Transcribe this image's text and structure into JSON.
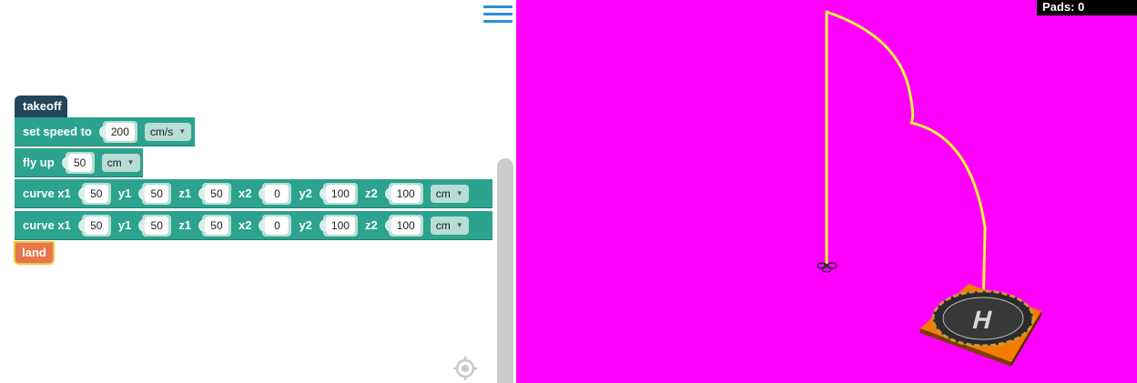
{
  "menu": {
    "icon": "hamburger-menu-icon"
  },
  "blocks": {
    "takeoff": {
      "label": "takeoff",
      "color": "#24465c"
    },
    "set_speed": {
      "label": "set speed to",
      "value": "200",
      "unit": "cm/s"
    },
    "fly_up": {
      "label": "fly up",
      "value": "50",
      "unit": "cm"
    },
    "curves": [
      {
        "label": "curve x1",
        "x1": "50",
        "y1_label": "y1",
        "y1": "50",
        "z1_label": "z1",
        "z1": "50",
        "x2_label": "x2",
        "x2": "0",
        "y2_label": "y2",
        "y2": "100",
        "z2_label": "z2",
        "z2": "100",
        "unit": "cm"
      },
      {
        "label": "curve x1",
        "x1": "50",
        "y1_label": "y1",
        "y1": "50",
        "z1_label": "z1",
        "z1": "50",
        "x2_label": "x2",
        "x2": "0",
        "y2_label": "y2",
        "y2": "100",
        "z2_label": "z2",
        "z2": "100",
        "unit": "cm"
      }
    ],
    "land": {
      "label": "land",
      "color": "#e6764a"
    }
  },
  "controls": {
    "recenter_icon": "target-recenter-icon"
  },
  "simulator": {
    "background": "#ff00ff",
    "pads_label": "Pads: 0",
    "path_color": "#f2f23a",
    "helipad_letter": "H"
  }
}
